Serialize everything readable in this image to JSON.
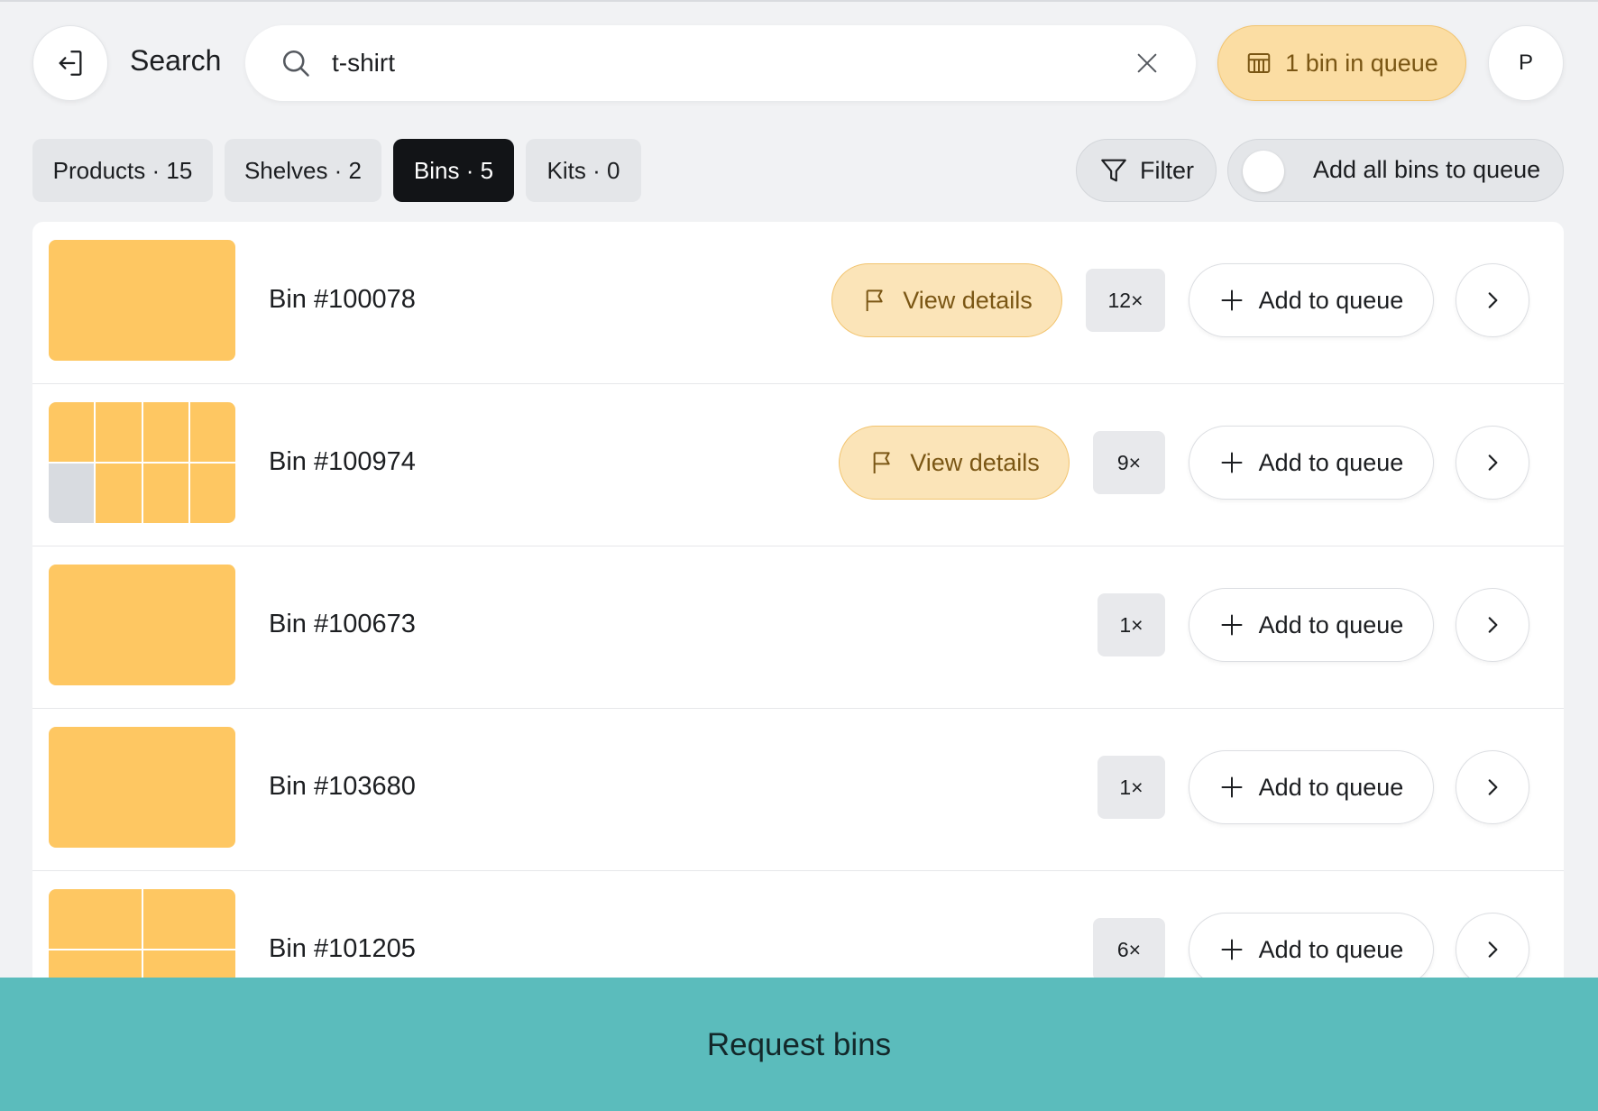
{
  "header": {
    "title": "Search",
    "search": {
      "value": "t-shirt",
      "placeholder": ""
    },
    "queue_label": "1 bin in queue",
    "avatar_initial": "P"
  },
  "tabs": [
    {
      "label": "Products · 15",
      "active": false
    },
    {
      "label": "Shelves · 2",
      "active": false
    },
    {
      "label": "Bins · 5",
      "active": true
    },
    {
      "label": "Kits · 0",
      "active": false
    }
  ],
  "filter_label": "Filter",
  "toggle_label": "Add all bins to queue",
  "rows": [
    {
      "label": "Bin #100078",
      "qty": "12×",
      "view_details": "View details",
      "add": "Add to queue"
    },
    {
      "label": "Bin #100974",
      "qty": "9×",
      "view_details": "View details",
      "add": "Add to queue"
    },
    {
      "label": "Bin #100673",
      "qty": "1×",
      "add": "Add to queue"
    },
    {
      "label": "Bin #103680",
      "qty": "1×",
      "add": "Add to queue"
    },
    {
      "label": "Bin #101205",
      "qty": "6×",
      "add": "Add to queue"
    }
  ],
  "footer_label": "Request bins",
  "colors": {
    "accent_teal": "#5bbcbc",
    "bin_yellow": "#fec762",
    "queue_pill": "#fbdda3",
    "active_tab": "#121417"
  }
}
